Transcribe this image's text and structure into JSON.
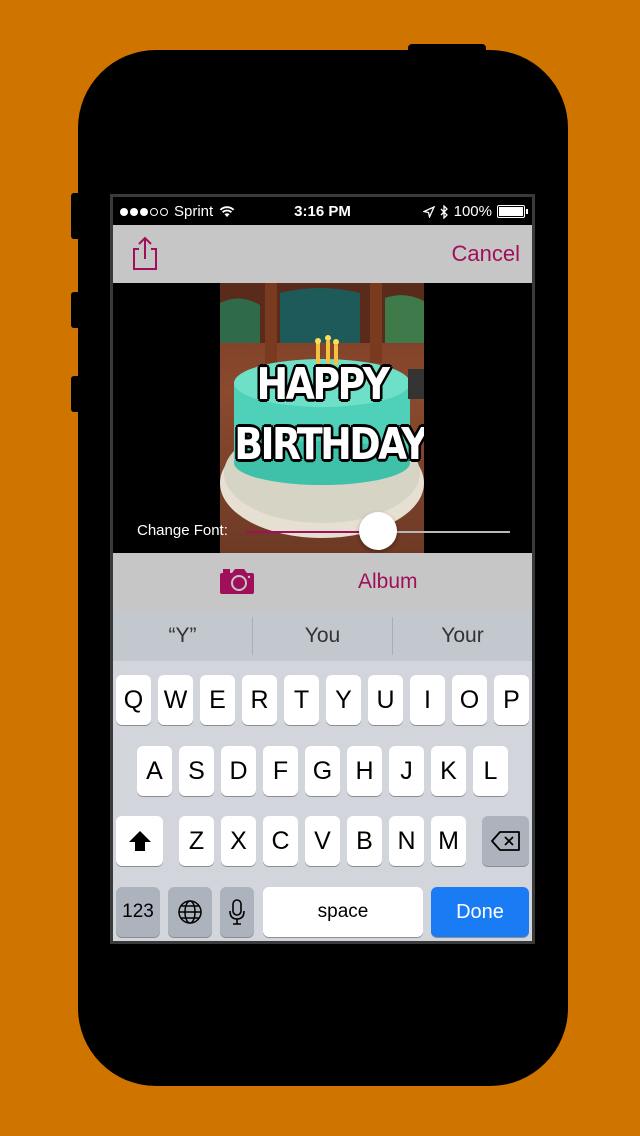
{
  "status_bar": {
    "carrier": "Sprint",
    "time": "3:16 PM",
    "battery": "100%",
    "signal_bars_filled": 3
  },
  "nav": {
    "share_icon": "share-icon",
    "cancel_label": "Cancel"
  },
  "image": {
    "meme_line1": "HAPPY",
    "meme_line2": "BIRTHDAY"
  },
  "font_slider": {
    "label": "Change Font:",
    "value": 0.5
  },
  "toolbar": {
    "camera_icon": "camera-icon",
    "album_label": "Album"
  },
  "keyboard": {
    "suggestions": [
      "“Y”",
      "You",
      "Your"
    ],
    "row1": [
      "Q",
      "W",
      "E",
      "R",
      "T",
      "Y",
      "U",
      "I",
      "O",
      "P"
    ],
    "row2": [
      "A",
      "S",
      "D",
      "F",
      "G",
      "H",
      "J",
      "K",
      "L"
    ],
    "row3": [
      "Z",
      "X",
      "C",
      "V",
      "B",
      "N",
      "M"
    ],
    "numbers_label": "123",
    "space_label": "space",
    "done_label": "Done"
  },
  "colors": {
    "accent": "#a0105a",
    "background": "#d07400",
    "done_key": "#1a7cf5"
  }
}
